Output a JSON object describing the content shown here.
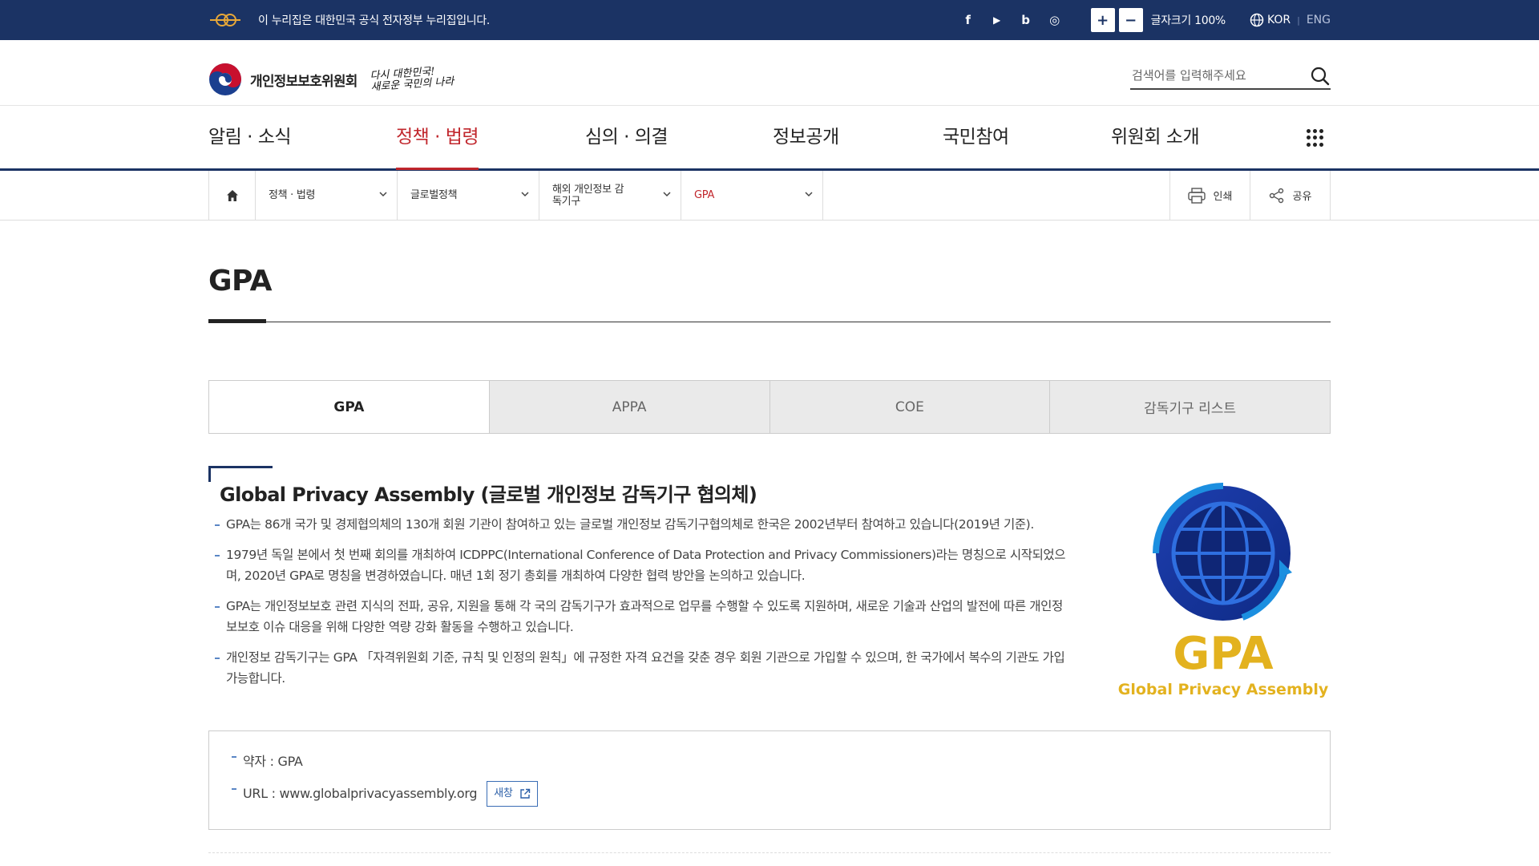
{
  "govbar": {
    "notice": "이 누리집은 대한민국 공식 전자정부 누리집입니다.",
    "sns": [
      {
        "icon": "facebook-icon",
        "glyph": "f"
      },
      {
        "icon": "youtube-icon",
        "glyph": "▶"
      },
      {
        "icon": "blog-icon",
        "glyph": "b"
      },
      {
        "icon": "instagram-icon",
        "glyph": "◎"
      }
    ],
    "font_plus": "+",
    "font_minus": "−",
    "font_size_label": "글자크기 100%",
    "lang_kor": "KOR",
    "lang_eng": "ENG"
  },
  "header": {
    "org_name": "개인정보보호위원회",
    "slogan_line1": "다시 대한민국!",
    "slogan_line2": "새로운 국민의 나라",
    "search_placeholder": "검색어를 입력해주세요"
  },
  "gnb": {
    "items": [
      "알림 · 소식",
      "정책 · 법령",
      "심의 · 의결",
      "정보공개",
      "국민참여",
      "위원회 소개"
    ],
    "active_index": 1
  },
  "location": {
    "sel1": "정책 · 법령",
    "sel2": "글로벌정책",
    "sel3": "해외 개인정보 감독기구",
    "sel4": "GPA",
    "print": "인쇄",
    "share": "공유"
  },
  "page": {
    "title": "GPA"
  },
  "tabs": {
    "items": [
      "GPA",
      "APPA",
      "COE",
      "감독기구 리스트"
    ],
    "active_index": 0
  },
  "section": {
    "title": "Global Privacy Assembly (글로벌 개인정보 감독기구 협의체)",
    "bullets": [
      "GPA는 86개 국가 및 경제협의체의 130개 회원 기관이 참여하고 있는 글로벌 개인정보 감독기구협의체로 한국은 2002년부터 참여하고 있습니다(2019년 기준).",
      "1979년 독일 본에서 첫 번째 회의를 개최하여 ICDPPC(International Conference of Data Protection and Privacy Commissioners)라는 명칭으로 시작되었으며, 2020년 GPA로 명칭을 변경하였습니다. 매년 1회 정기 총회를 개최하여 다양한 협력 방안을 논의하고 있습니다.",
      "GPA는 개인정보보호 관련 지식의 전파, 공유, 지원을 통해 각 국의 감독기구가 효과적으로 업무를 수행할 수 있도록 지원하며, 새로운 기술과 산업의 발전에 따른 개인정보보호 이슈 대응을 위해 다양한 역량 강화 활동을 수행하고 있습니다.",
      "개인정보 감독기구는 GPA 「자격위원회 기준, 규칙 및 인정의 원칙」에 규정한 자격 요건을 갖춘 경우 회원 기관으로 가입할 수 있으며, 한 국가에서 복수의 기관도 가입 가능합니다."
    ],
    "logo_text": "GPA",
    "logo_subtext": "Global Privacy Assembly"
  },
  "info": {
    "abbr": "약자 : GPA",
    "url": "URL : www.globalprivacyassembly.org",
    "newwin": "새창"
  },
  "colors": {
    "navy": "#1b3364",
    "accent_red": "#c1272d",
    "gpa_blue": "#1a3a9e",
    "gpa_gold": "#e3b21f"
  }
}
